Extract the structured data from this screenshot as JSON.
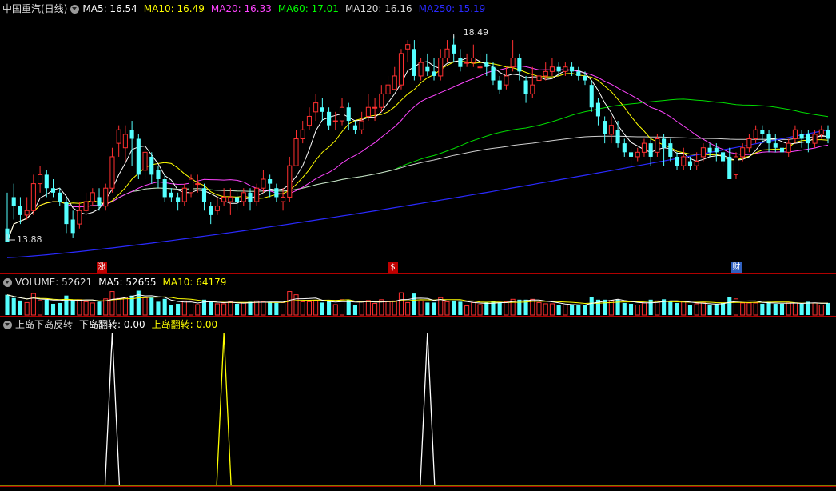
{
  "price_panel": {
    "title": "中国重汽(日线)",
    "legend": [
      {
        "label": "MA5: 16.54",
        "color": "#ffffff"
      },
      {
        "label": "MA10: 16.49",
        "color": "#ffff00"
      },
      {
        "label": "MA20: 16.33",
        "color": "#ff44ff"
      },
      {
        "label": "MA60: 17.01",
        "color": "#00ff00"
      },
      {
        "label": "MA120: 16.16",
        "color": "#d8d8d8"
      },
      {
        "label": "MA250: 15.19",
        "color": "#2a2aff"
      }
    ],
    "high_label": "18.49",
    "low_label": "13.88",
    "badges": [
      {
        "text": "涨",
        "color": "#c00000"
      },
      {
        "text": "$",
        "color": "#c00000"
      },
      {
        "text": "财",
        "color": "#3060c0"
      }
    ]
  },
  "volume_panel": {
    "legend": [
      {
        "label": "VOLUME: 52621",
        "color": "#dddddd"
      },
      {
        "label": "MA5: 52655",
        "color": "#ffffff"
      },
      {
        "label": "MA10: 64179",
        "color": "#ffff00"
      }
    ]
  },
  "indicator_panel": {
    "legend": [
      {
        "label": "上岛下岛反转",
        "color": "#dddddd"
      },
      {
        "label": "下岛翻转: 0.00",
        "color": "#ffffff"
      },
      {
        "label": "上岛翻转: 0.00",
        "color": "#ffff00"
      }
    ]
  },
  "colors": {
    "up": "#ff3030",
    "down": "#54ffff",
    "background": "#000000"
  },
  "chart_data": {
    "type": "candlestick",
    "price_range": [
      13.5,
      18.9
    ],
    "candles": [
      [
        14.2,
        13.9,
        14.0,
        15.0
      ],
      [
        14.9,
        14.7,
        14.4,
        15.2
      ],
      [
        14.7,
        14.5,
        14.3,
        14.9
      ],
      [
        14.5,
        14.6,
        14.4,
        14.9
      ],
      [
        14.6,
        15.2,
        14.5,
        15.4
      ],
      [
        15.2,
        15.4,
        15.0,
        15.6
      ],
      [
        15.4,
        15.1,
        14.9,
        15.5
      ],
      [
        15.1,
        15.0,
        14.9,
        15.3
      ],
      [
        15.0,
        14.8,
        14.7,
        15.1
      ],
      [
        14.8,
        14.3,
        14.1,
        14.9
      ],
      [
        14.4,
        14.1,
        14.0,
        14.6
      ],
      [
        14.3,
        14.6,
        14.2,
        14.8
      ],
      [
        14.6,
        14.8,
        14.5,
        15.0
      ],
      [
        14.8,
        15.0,
        14.7,
        15.1
      ],
      [
        14.9,
        14.7,
        14.6,
        15.1
      ],
      [
        14.7,
        15.1,
        14.6,
        15.2
      ],
      [
        15.1,
        15.8,
        15.0,
        16.0
      ],
      [
        16.1,
        16.4,
        15.8,
        16.5
      ],
      [
        16.0,
        16.3,
        15.7,
        16.5
      ],
      [
        16.4,
        16.2,
        15.6,
        16.6
      ],
      [
        16.2,
        15.4,
        15.3,
        16.3
      ],
      [
        15.5,
        15.9,
        15.3,
        16.0
      ],
      [
        15.8,
        15.4,
        15.2,
        15.9
      ],
      [
        15.5,
        15.3,
        15.1,
        15.6
      ],
      [
        15.3,
        14.9,
        14.8,
        15.4
      ],
      [
        15.0,
        14.9,
        14.8,
        15.1
      ],
      [
        14.9,
        14.8,
        14.6,
        15.0
      ],
      [
        14.8,
        15.1,
        14.7,
        15.2
      ],
      [
        15.0,
        15.3,
        14.9,
        15.4
      ],
      [
        15.2,
        15.2,
        15.0,
        15.4
      ],
      [
        15.1,
        14.8,
        14.6,
        15.2
      ],
      [
        14.7,
        14.5,
        14.3,
        14.8
      ],
      [
        14.6,
        14.7,
        14.5,
        14.9
      ],
      [
        14.8,
        14.9,
        14.7,
        15.1
      ],
      [
        14.8,
        14.9,
        14.5,
        15.1
      ],
      [
        14.9,
        14.8,
        14.6,
        15.0
      ],
      [
        14.8,
        15.0,
        14.7,
        15.1
      ],
      [
        15.0,
        14.8,
        14.6,
        15.1
      ],
      [
        14.8,
        15.1,
        14.7,
        15.2
      ],
      [
        15.1,
        15.3,
        15.0,
        15.5
      ],
      [
        15.3,
        15.2,
        14.9,
        15.4
      ],
      [
        15.1,
        14.9,
        14.8,
        15.2
      ],
      [
        14.8,
        14.9,
        14.6,
        15.1
      ],
      [
        14.9,
        15.6,
        14.8,
        15.8
      ],
      [
        15.6,
        16.2,
        15.6,
        16.4
      ],
      [
        16.2,
        16.4,
        16.1,
        16.6
      ],
      [
        16.5,
        16.7,
        16.4,
        16.9
      ],
      [
        16.8,
        17.0,
        16.6,
        17.2
      ],
      [
        16.9,
        16.8,
        16.6,
        17.1
      ],
      [
        16.8,
        16.5,
        16.4,
        16.9
      ],
      [
        16.6,
        16.6,
        16.4,
        16.8
      ],
      [
        16.6,
        16.9,
        16.5,
        17.1
      ],
      [
        16.9,
        16.6,
        16.4,
        17.0
      ],
      [
        16.5,
        16.4,
        16.3,
        16.6
      ],
      [
        16.4,
        16.6,
        16.3,
        16.8
      ],
      [
        16.7,
        16.9,
        16.6,
        17.2
      ],
      [
        16.9,
        16.9,
        16.6,
        17.1
      ],
      [
        16.9,
        17.2,
        16.8,
        17.4
      ],
      [
        17.2,
        17.4,
        17.1,
        17.6
      ],
      [
        17.3,
        17.6,
        17.3,
        17.8
      ],
      [
        17.4,
        18.1,
        17.3,
        18.2
      ],
      [
        18.2,
        18.3,
        17.9,
        18.4
      ],
      [
        18.2,
        17.6,
        17.5,
        18.4
      ],
      [
        17.6,
        17.9,
        17.5,
        18.0
      ],
      [
        17.8,
        17.7,
        17.6,
        18.1
      ],
      [
        17.7,
        17.6,
        17.5,
        18.0
      ],
      [
        17.6,
        18.0,
        17.5,
        18.2
      ],
      [
        18.0,
        18.2,
        17.9,
        18.4
      ],
      [
        18.3,
        18.1,
        17.9,
        18.5
      ],
      [
        18.0,
        17.8,
        17.7,
        18.2
      ],
      [
        17.9,
        17.9,
        17.8,
        18.1
      ],
      [
        17.9,
        18.0,
        17.8,
        18.3
      ],
      [
        17.8,
        17.8,
        17.7,
        18.1
      ],
      [
        17.9,
        17.8,
        17.6,
        18.1
      ],
      [
        17.8,
        17.5,
        17.4,
        17.9
      ],
      [
        17.5,
        17.3,
        17.2,
        17.6
      ],
      [
        17.4,
        17.6,
        17.3,
        17.8
      ],
      [
        17.8,
        18.0,
        17.7,
        18.4
      ],
      [
        18.0,
        17.7,
        17.5,
        18.1
      ],
      [
        17.5,
        17.2,
        17.0,
        17.6
      ],
      [
        17.2,
        17.4,
        17.1,
        17.8
      ],
      [
        17.5,
        17.6,
        17.3,
        17.8
      ],
      [
        17.6,
        17.7,
        17.5,
        17.9
      ],
      [
        17.7,
        17.8,
        17.6,
        18.0
      ],
      [
        17.8,
        17.7,
        17.6,
        17.9
      ],
      [
        17.7,
        17.8,
        17.6,
        17.9
      ],
      [
        17.8,
        17.7,
        17.6,
        17.9
      ],
      [
        17.7,
        17.6,
        17.5,
        17.8
      ],
      [
        17.6,
        17.5,
        17.4,
        17.7
      ],
      [
        17.4,
        16.9,
        16.8,
        17.5
      ],
      [
        17.0,
        16.7,
        16.5,
        17.1
      ],
      [
        16.6,
        16.3,
        16.1,
        16.7
      ],
      [
        16.3,
        16.5,
        16.1,
        16.7
      ],
      [
        16.4,
        16.1,
        16.0,
        16.6
      ],
      [
        16.1,
        15.9,
        15.8,
        16.2
      ],
      [
        15.9,
        15.8,
        15.6,
        16.0
      ],
      [
        15.8,
        15.9,
        15.7,
        16.0
      ],
      [
        15.9,
        16.1,
        15.8,
        16.2
      ],
      [
        16.1,
        15.8,
        15.6,
        16.2
      ],
      [
        15.9,
        16.2,
        15.8,
        16.3
      ],
      [
        16.2,
        16.0,
        15.6,
        16.3
      ],
      [
        16.1,
        15.8,
        15.7,
        16.2
      ],
      [
        15.8,
        15.6,
        15.5,
        15.9
      ],
      [
        15.6,
        15.8,
        15.5,
        16.0
      ],
      [
        15.7,
        15.6,
        15.5,
        15.8
      ],
      [
        15.6,
        15.7,
        15.5,
        15.9
      ],
      [
        15.8,
        16.0,
        15.7,
        16.1
      ],
      [
        16.0,
        15.9,
        15.8,
        16.1
      ],
      [
        16.0,
        15.9,
        15.7,
        16.1
      ],
      [
        15.9,
        15.7,
        15.6,
        16.0
      ],
      [
        15.8,
        15.3,
        15.3,
        16.0
      ],
      [
        15.4,
        15.8,
        15.3,
        15.9
      ],
      [
        15.8,
        16.0,
        15.7,
        16.1
      ],
      [
        16.0,
        16.2,
        15.9,
        16.3
      ],
      [
        16.2,
        16.4,
        16.1,
        16.5
      ],
      [
        16.4,
        16.3,
        16.1,
        16.5
      ],
      [
        16.3,
        16.1,
        15.9,
        16.4
      ],
      [
        16.1,
        16.0,
        15.9,
        16.3
      ],
      [
        16.0,
        15.9,
        15.7,
        16.1
      ],
      [
        15.9,
        16.1,
        15.8,
        16.2
      ],
      [
        16.2,
        16.4,
        16.1,
        16.5
      ],
      [
        16.3,
        16.2,
        16.0,
        16.4
      ],
      [
        16.3,
        16.1,
        15.9,
        16.4
      ],
      [
        16.1,
        16.3,
        16.0,
        16.4
      ],
      [
        16.3,
        16.4,
        16.2,
        16.5
      ],
      [
        16.4,
        16.2,
        16.1,
        16.5
      ]
    ],
    "volume_ma_levels": {
      "ma5": 52655,
      "ma10": 64179
    },
    "indicator_spikes": [
      {
        "index": 16,
        "series": "下岛翻转"
      },
      {
        "index": 33,
        "series": "上岛翻转"
      },
      {
        "index": 64,
        "series": "下岛翻转"
      }
    ]
  }
}
